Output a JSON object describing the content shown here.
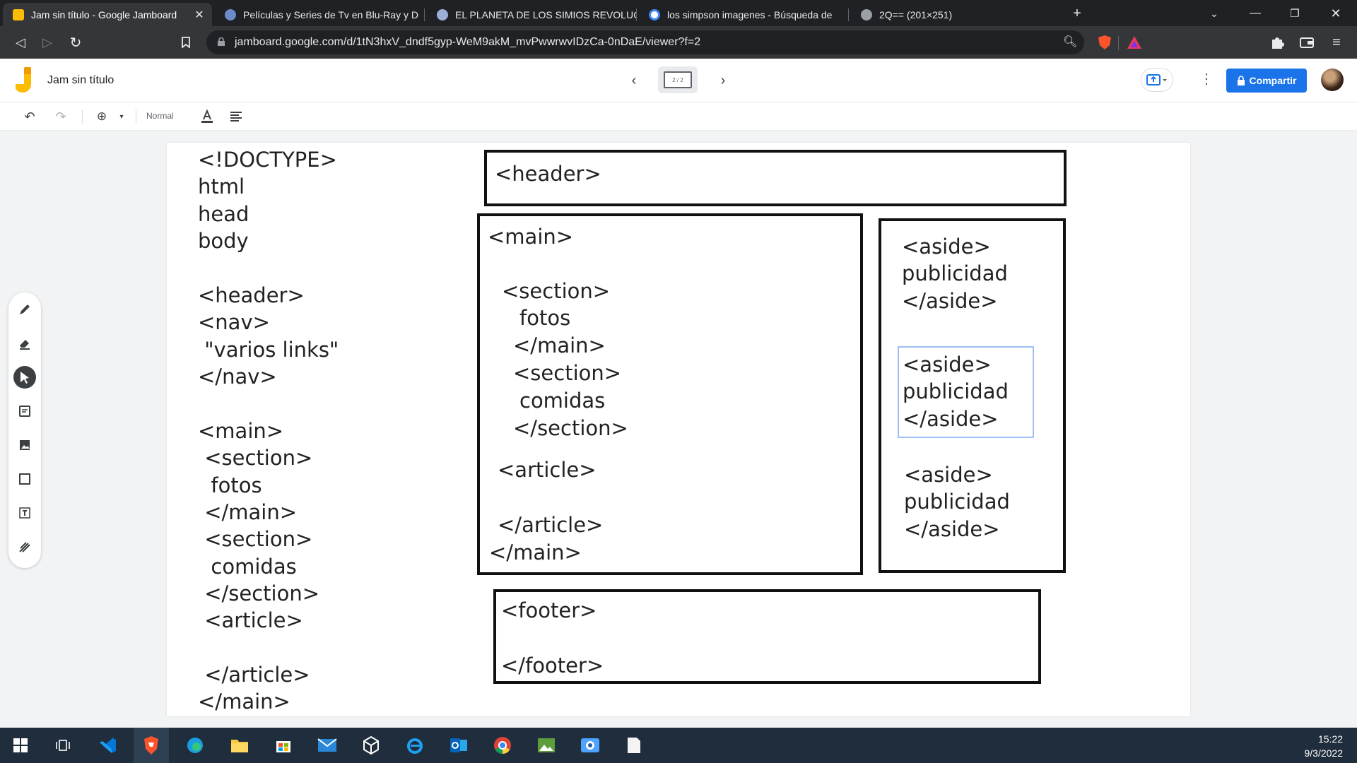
{
  "browser": {
    "tabs": [
      {
        "title": "Jam sin título - Google Jamboard",
        "active": true,
        "favicon": "jamboard-icon"
      },
      {
        "title": "Películas y Series de Tv en Blu-Ray y D",
        "active": false,
        "favicon": "globe-icon"
      },
      {
        "title": "EL PLANETA DE LOS SIMIOS REVOLUC",
        "active": false,
        "favicon": "planet-icon"
      },
      {
        "title": "los simpson imagenes - Búsqueda de",
        "active": false,
        "favicon": "google-icon"
      },
      {
        "title": "2Q== (201×251)",
        "active": false,
        "favicon": "globe-icon"
      }
    ],
    "new_tab": "+",
    "url": "jamboard.google.com/d/1tN3hxV_dndf5gyp-WeM9akM_mvPwwrwvIDzCa-0nDaE/viewer?f=2"
  },
  "jam": {
    "title": "Jam sin título",
    "frame_indicator": "2 / 2",
    "share_label": "Compartir",
    "text_style": "Normal",
    "accent": "#1a73e8",
    "logo_color": "#fbbc04"
  },
  "canvas": {
    "left_outline": [
      "<!DOCTYPE>",
      "html",
      "head",
      "body",
      "",
      "<header>",
      "<nav>",
      " \"varios links\"",
      "</nav>",
      "",
      "<main>",
      " <section>",
      "  fotos",
      " </main>",
      " <section>",
      "  comidas",
      " </section>",
      " <article>",
      "",
      " </article>",
      "</main>"
    ],
    "header_box": "<header>",
    "main_box": {
      "open": "<main>",
      "section1_open": "<section>",
      "section1_text": "fotos",
      "section1_close": "</main>",
      "section2_open": "<section>",
      "section2_text": "comidas",
      "section2_close": "</section>",
      "article_open": "<article>",
      "article_close": "</article>",
      "close": "</main>"
    },
    "asides": [
      {
        "open": "<aside>",
        "text": "publicidad",
        "close": "</aside>"
      },
      {
        "open": "<aside>",
        "text": "publicidad",
        "close": "</aside>"
      },
      {
        "open": "<aside>",
        "text": "publicidad",
        "close": "</aside>"
      }
    ],
    "footer_box": {
      "open": "<footer>",
      "close": "</footer>"
    }
  },
  "taskbar": {
    "time": "15:22",
    "date": "9/3/2022",
    "apps": [
      "windows-start-icon",
      "task-view-icon",
      "vscode-icon",
      "brave-icon",
      "edge-icon",
      "file-explorer-icon",
      "store-icon",
      "mail-icon",
      "cube-icon",
      "ie-icon",
      "outlook-icon",
      "chrome-icon",
      "photos-icon",
      "camera-icon",
      "notepad-icon"
    ]
  }
}
